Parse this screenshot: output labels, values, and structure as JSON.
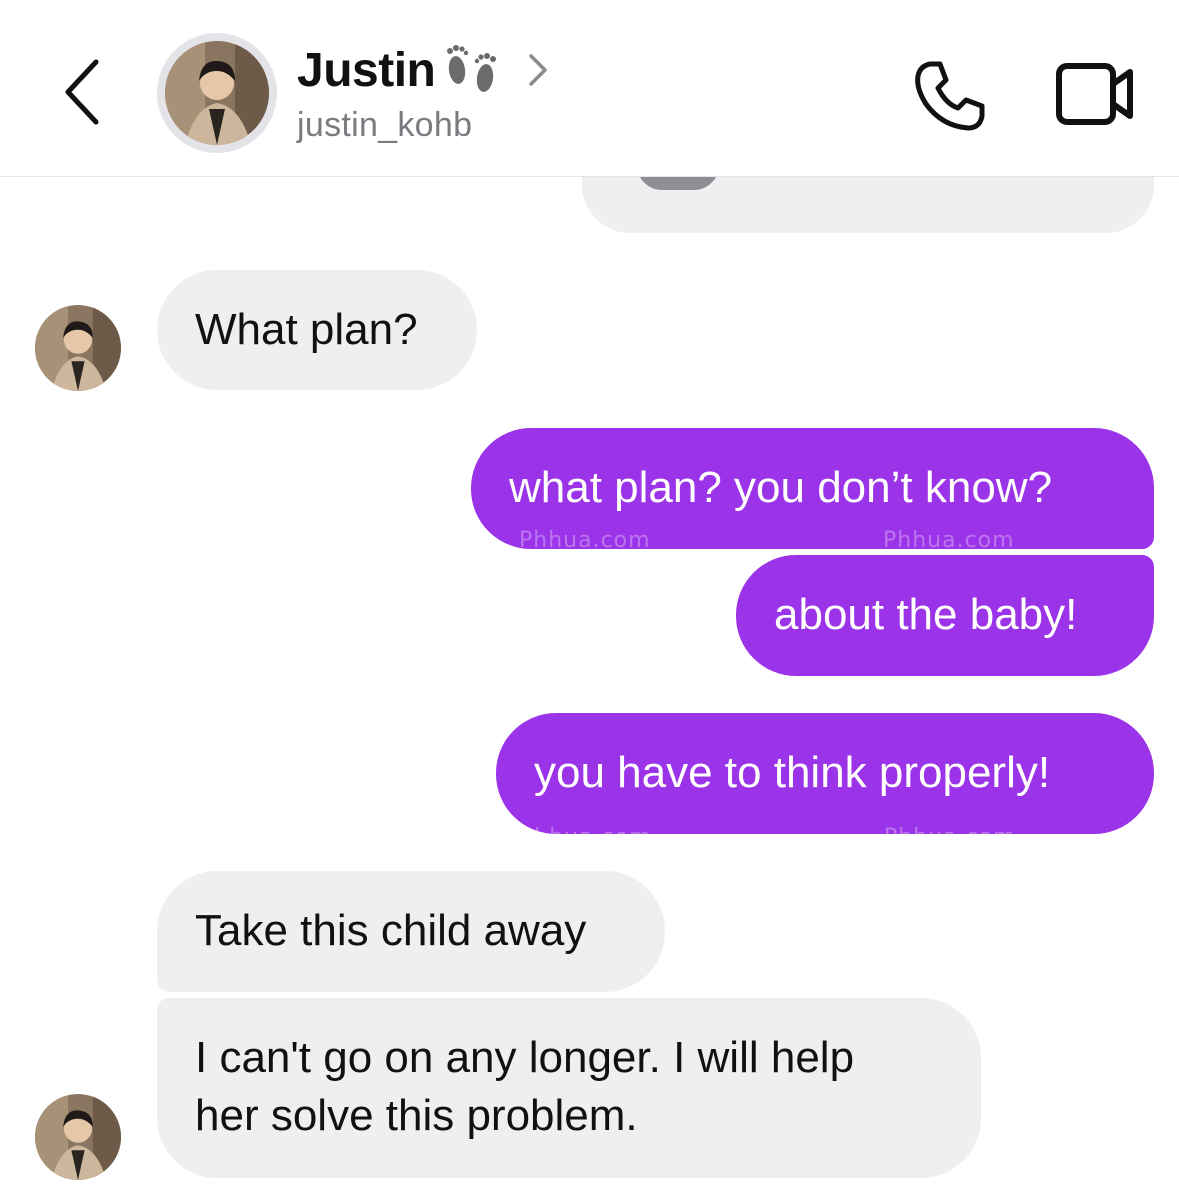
{
  "header": {
    "name": "Justin",
    "username": "justin_kohb",
    "name_emoji_icon": "footprints-icon",
    "back_icon": "chevron-left-icon",
    "details_icon": "chevron-right-icon",
    "call_icon": "phone-icon",
    "video_icon": "video-camera-icon"
  },
  "messages": [
    {
      "from": "them",
      "text": "What plan?"
    },
    {
      "from": "me",
      "text": "what plan? you don’t know?"
    },
    {
      "from": "me",
      "text": "about the baby!"
    },
    {
      "from": "me",
      "text": "you have to think properly!"
    },
    {
      "from": "them",
      "text": "Take this child away"
    },
    {
      "from": "them",
      "lines": [
        "I can't go on any longer. I will help",
        "her solve this problem."
      ]
    }
  ],
  "watermark": {
    "text": "Phhua.com"
  },
  "colors": {
    "outgoing_bubble": "#9b33e8",
    "incoming_bubble": "#efeff2",
    "text_primary": "#111111",
    "text_secondary": "#7a7a80"
  }
}
